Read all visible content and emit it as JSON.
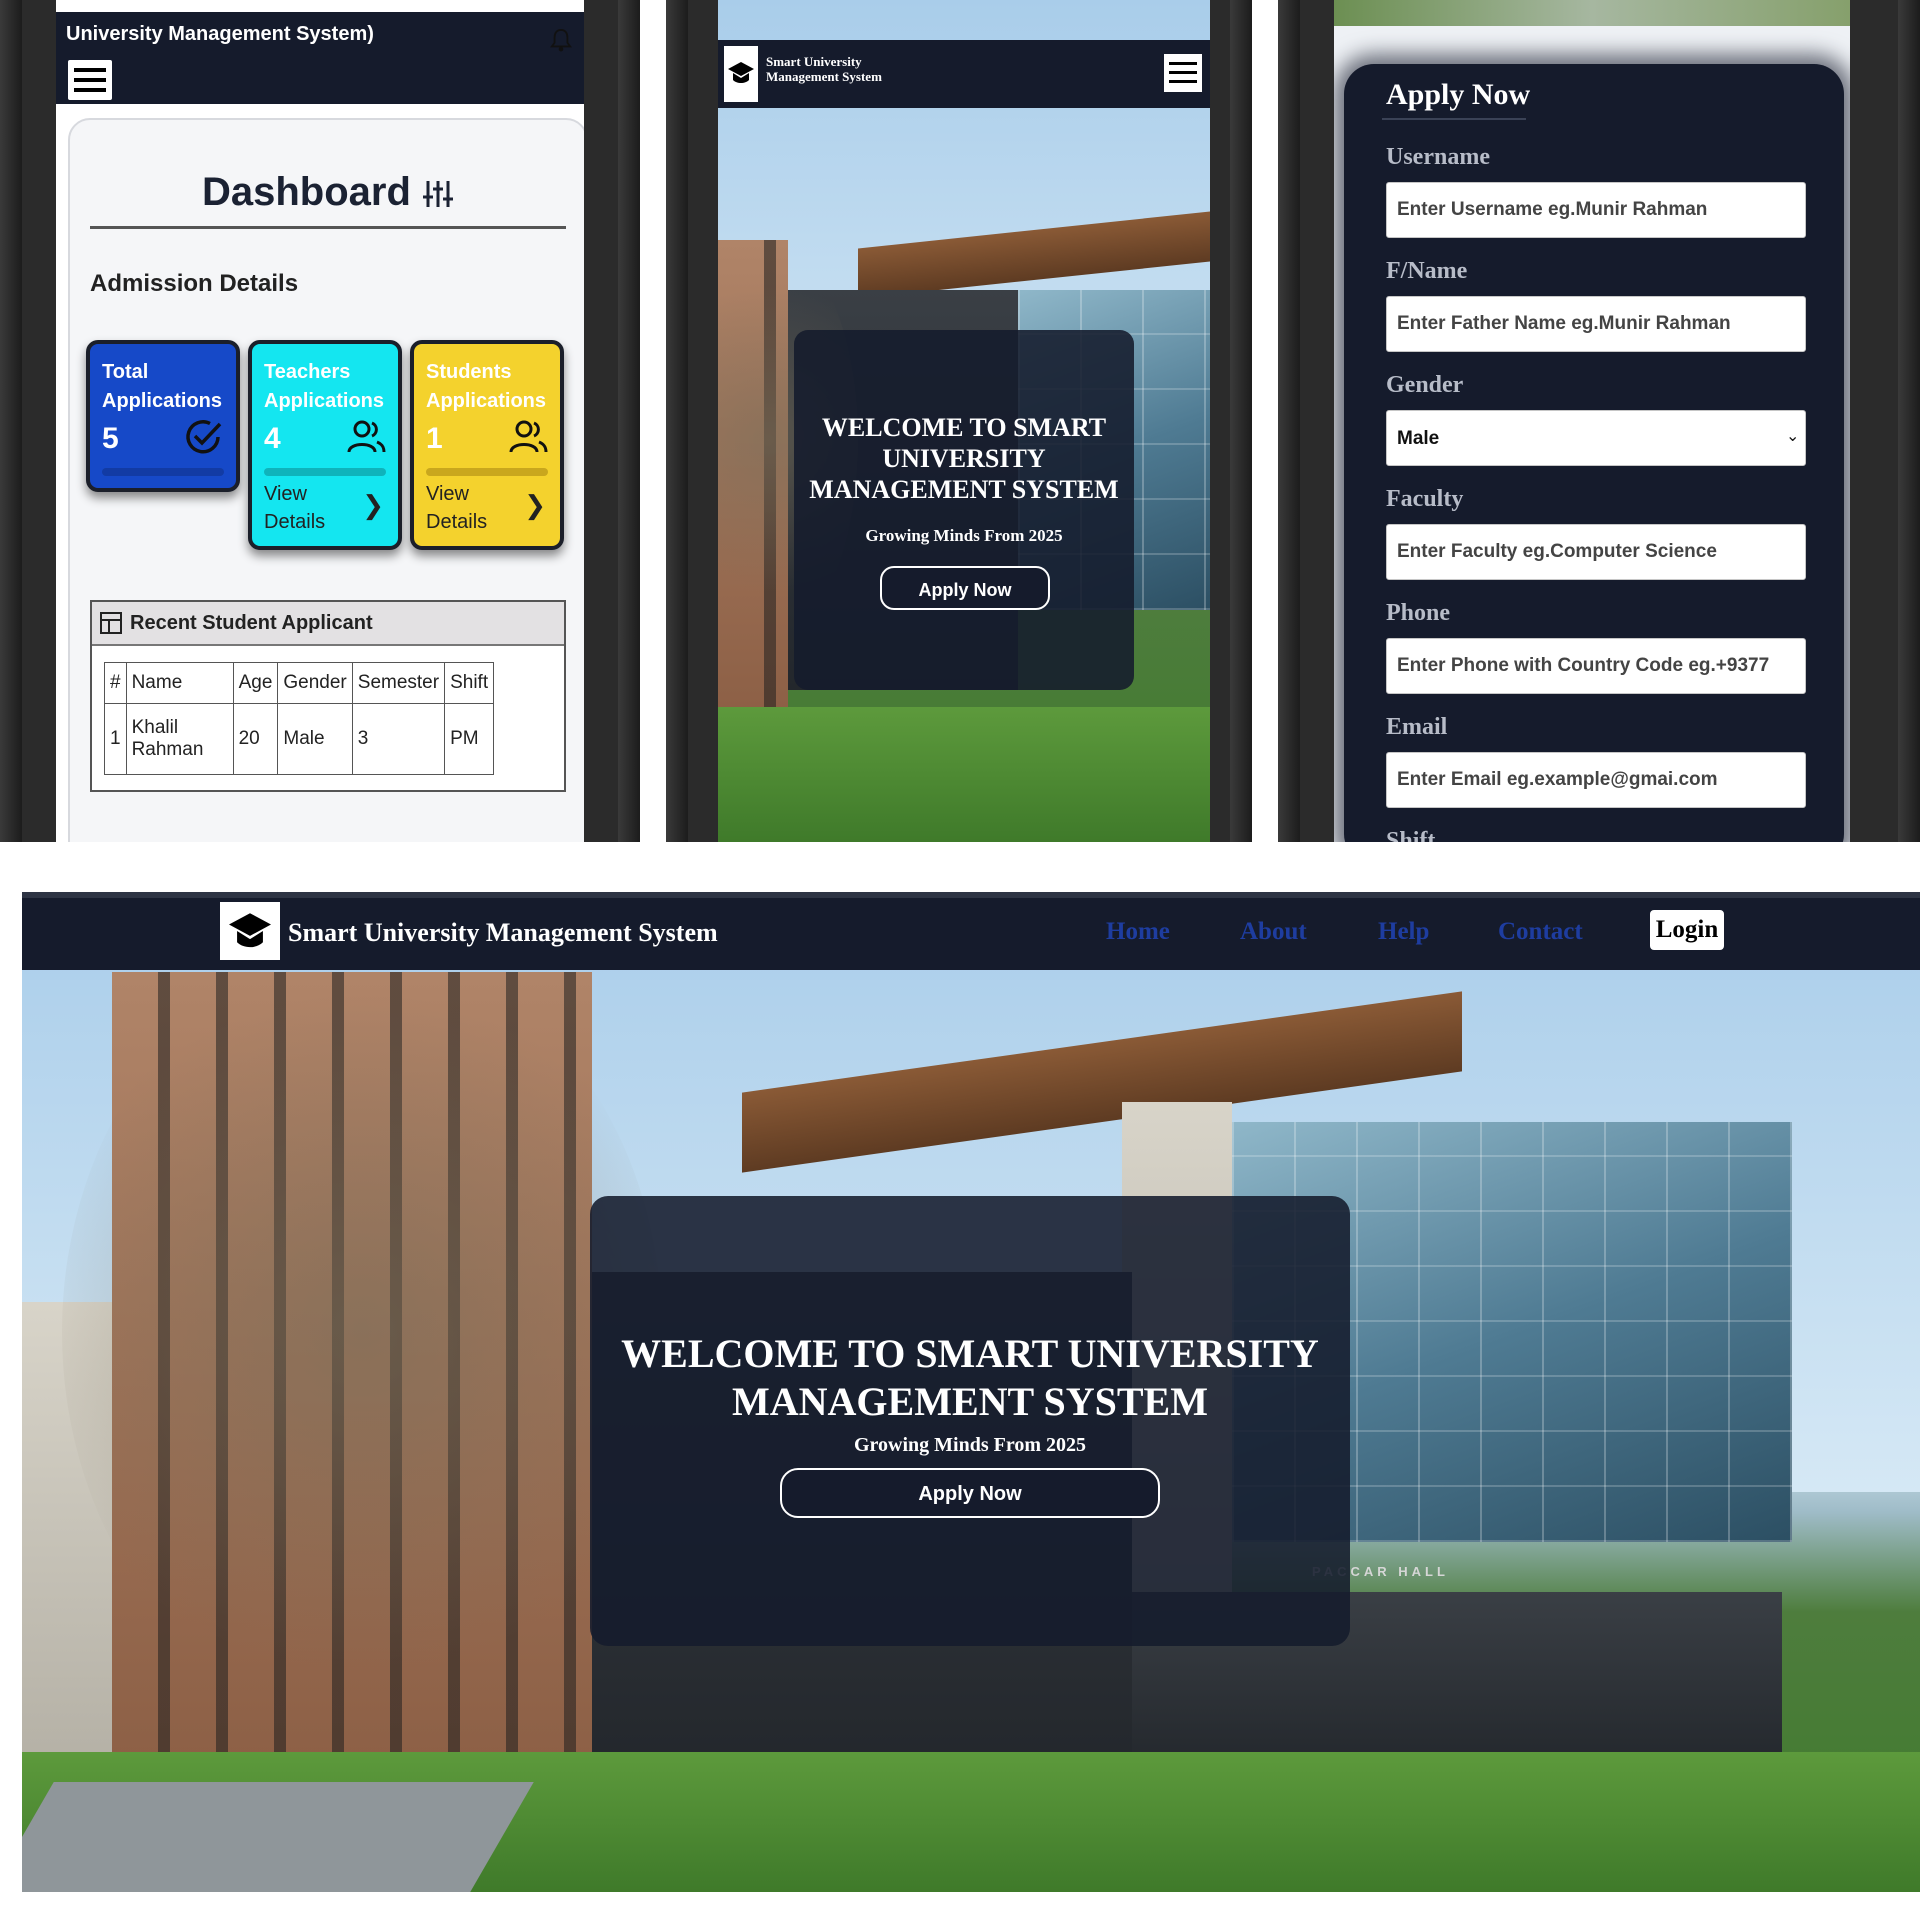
{
  "dashboard": {
    "topbar_title": "University Management System)",
    "title": "Dashboard",
    "section_title": "Admission Details",
    "stats": [
      {
        "label_line1": "Total",
        "label_line2": "Applications",
        "value": "5",
        "icon": "check-circle-icon",
        "color": "#1649c8"
      },
      {
        "label_line1": "Teachers",
        "label_line2": "Applications",
        "value": "4",
        "icon": "users-icon",
        "color": "#14e6f0",
        "view_line1": "View",
        "view_line2": "Details"
      },
      {
        "label_line1": "Students",
        "label_line2": "Applications",
        "value": "1",
        "icon": "users-icon",
        "color": "#f4d22d",
        "view_line1": "View",
        "view_line2": "Details"
      }
    ],
    "table_title": "Recent Student Applicant",
    "table_headers": [
      "#",
      "Name",
      "Age",
      "Gender",
      "Semester",
      "Shift"
    ],
    "table_rows": [
      {
        "num": "1",
        "name_line1": "Khalil",
        "name_line2": "Rahman",
        "age": "20",
        "gender": "Male",
        "semester": "3",
        "shift": "PM"
      }
    ]
  },
  "home_mobile": {
    "brand_line1": "Smart University",
    "brand_line2": "Management System",
    "welcome_line1": "WELCOME TO SMART",
    "welcome_line2": "UNIVERSITY",
    "welcome_line3": "MANAGEMENT SYSTEM",
    "tagline": "Growing Minds From 2025",
    "apply_label": "Apply Now"
  },
  "apply_form": {
    "title": "Apply Now",
    "fields": {
      "username_label": "Username",
      "username_placeholder": "Enter Username eg.Munir Rahman",
      "fname_label": "F/Name",
      "fname_placeholder": "Enter Father Name eg.Munir Rahman",
      "gender_label": "Gender",
      "gender_selected": "Male",
      "faculty_label": "Faculty",
      "faculty_placeholder": "Enter Faculty eg.Computer Science",
      "phone_label": "Phone",
      "phone_placeholder": "Enter Phone with Country Code eg.+9377",
      "email_label": "Email",
      "email_placeholder": "Enter Email eg.example@gmai.com",
      "shift_label": "Shift"
    }
  },
  "desktop": {
    "brand": "Smart University Management System",
    "nav": [
      "Home",
      "About",
      "Help",
      "Contact"
    ],
    "login_label": "Login",
    "welcome_line1": "WELCOME TO SMART UNIVERSITY",
    "welcome_line2": "MANAGEMENT SYSTEM",
    "tagline": "Growing Minds From 2025",
    "apply_label": "Apply Now",
    "building_sign": "PACCAR HALL"
  },
  "colors": {
    "navy": "#151b2c",
    "nav_link": "#1e3da0",
    "total": "#1649c8",
    "teachers": "#14e6f0",
    "students": "#f4d22d"
  }
}
